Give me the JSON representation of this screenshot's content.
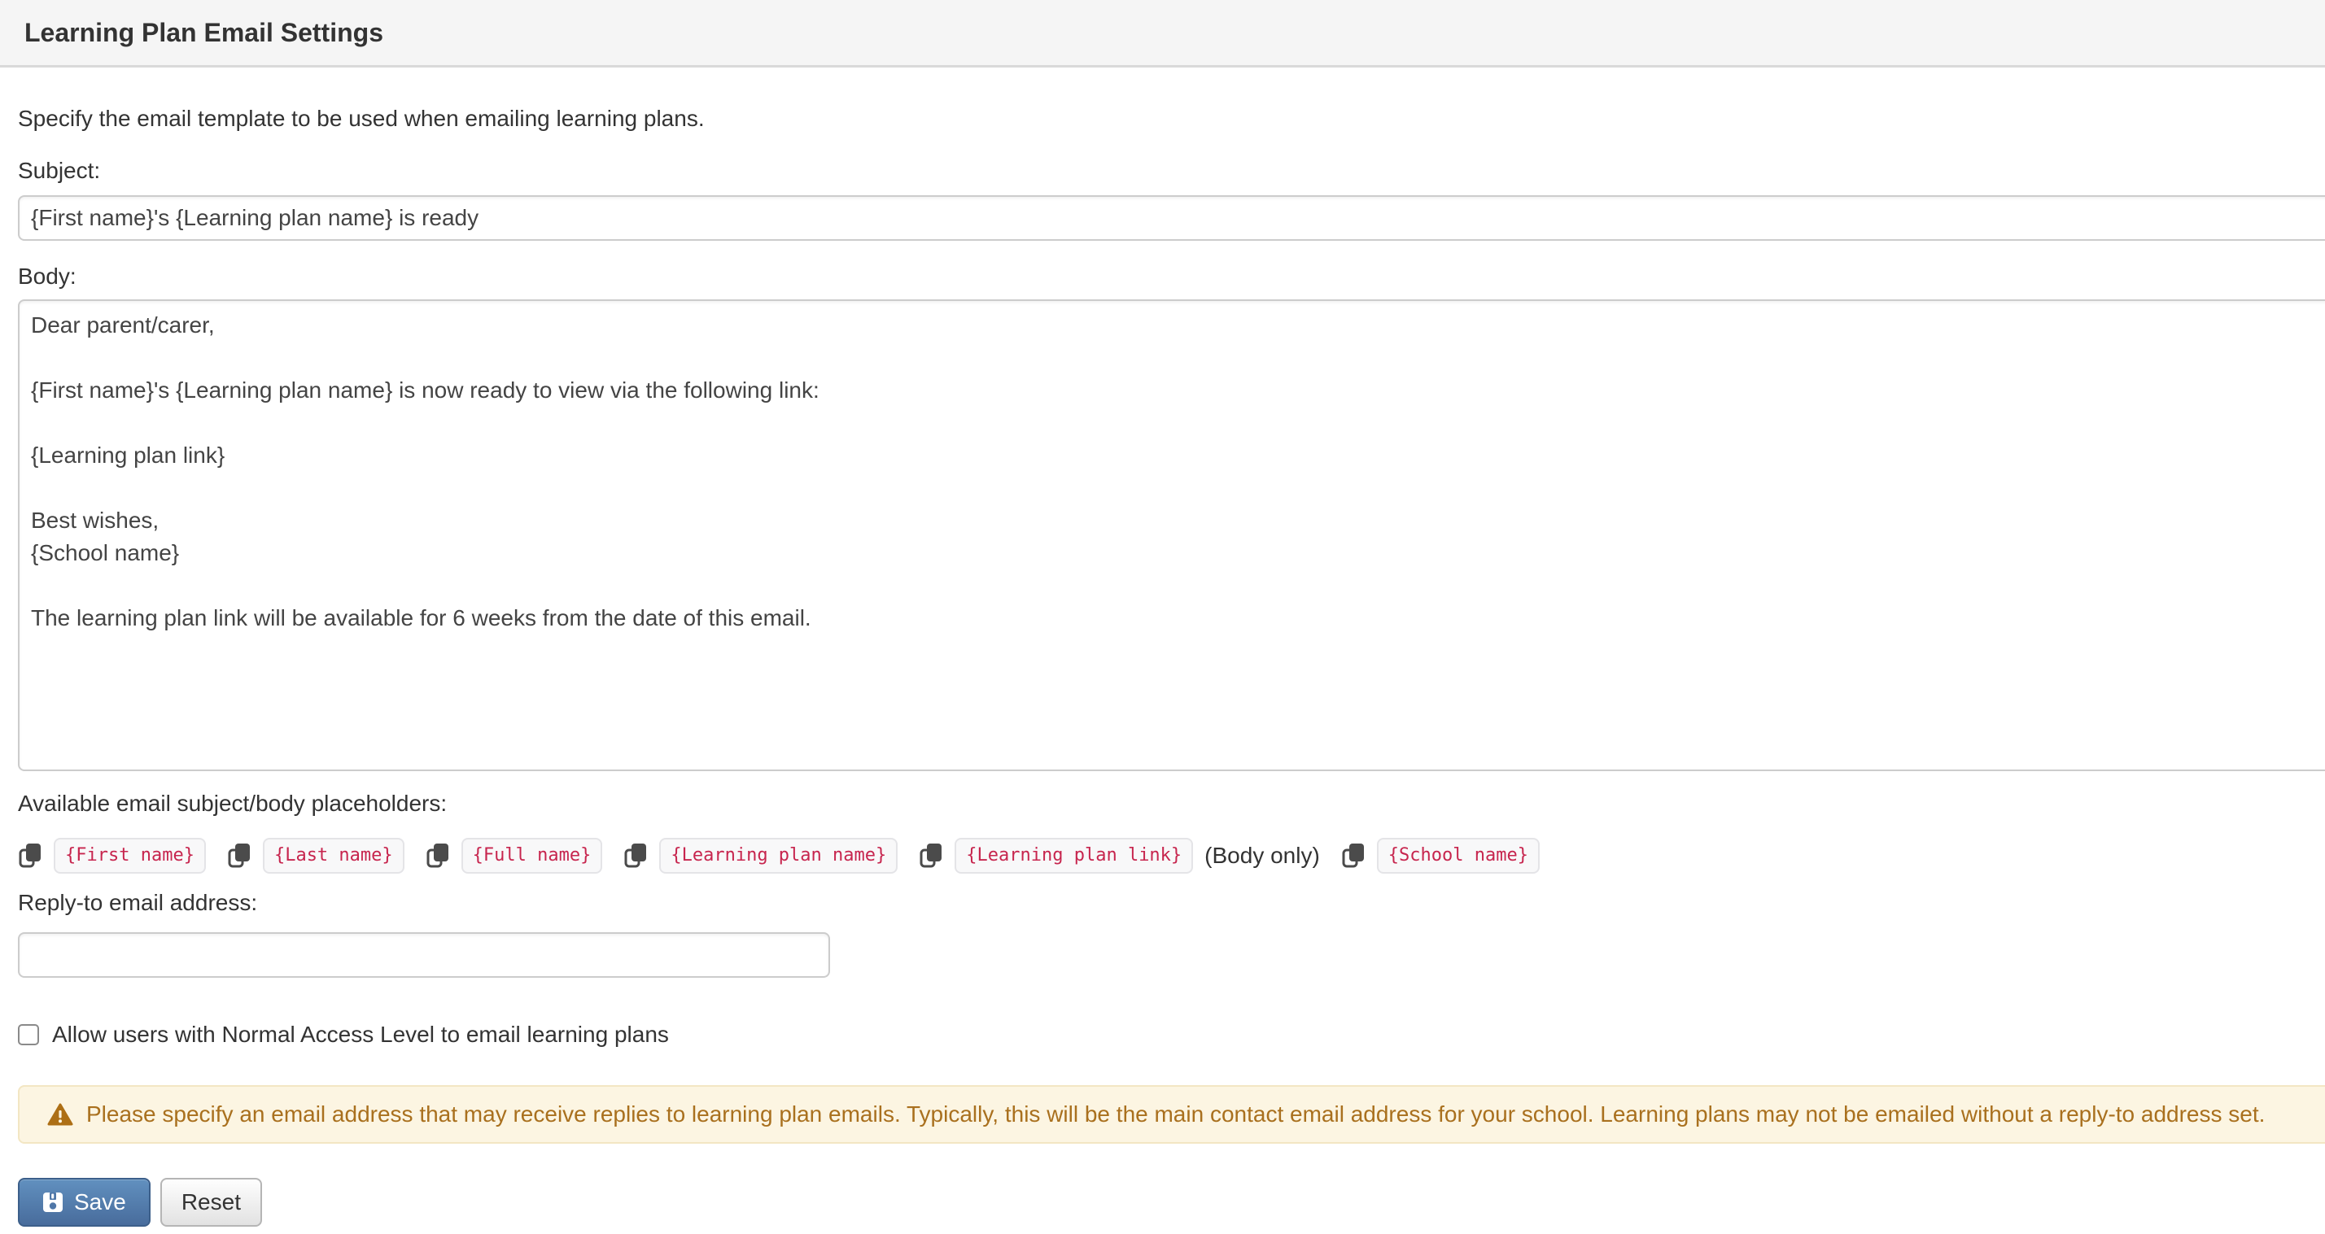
{
  "header": {
    "title": "Learning Plan Email Settings"
  },
  "intro": "Specify the email template to be used when emailing learning plans.",
  "subject": {
    "label": "Subject:",
    "value": "{First name}'s {Learning plan name} is ready"
  },
  "body": {
    "label": "Body:",
    "value": "Dear parent/carer,\n\n{First name}'s {Learning plan name} is now ready to view via the following link:\n\n{Learning plan link}\n\nBest wishes,\n{School name}\n\nThe learning plan link will be available for 6 weeks from the date of this email."
  },
  "placeholders": {
    "label": "Available email subject/body placeholders:",
    "items": [
      {
        "token": "{First name}",
        "note": ""
      },
      {
        "token": "{Last name}",
        "note": ""
      },
      {
        "token": "{Full name}",
        "note": ""
      },
      {
        "token": "{Learning plan name}",
        "note": ""
      },
      {
        "token": "{Learning plan link}",
        "note": "(Body only)"
      },
      {
        "token": "{School name}",
        "note": ""
      }
    ]
  },
  "reply_to": {
    "label": "Reply-to email address:",
    "value": ""
  },
  "access_checkbox": {
    "label": "Allow users with Normal Access Level to email learning plans",
    "checked": false
  },
  "warning": {
    "text": "Please specify an email address that may receive replies to learning plan emails. Typically, this will be the main contact email address for your school. Learning plans may not be emailed without a reply-to address set."
  },
  "buttons": {
    "save": "Save",
    "reset": "Reset"
  },
  "colors": {
    "header_bg": "#f5f5f5",
    "token_text": "#c7254e",
    "token_bg": "#f8f8f9",
    "warning_bg": "#fcf5e2",
    "warning_text": "#a9701e",
    "save_button_blue": "#4f77a8",
    "input_border": "#cccccc"
  }
}
